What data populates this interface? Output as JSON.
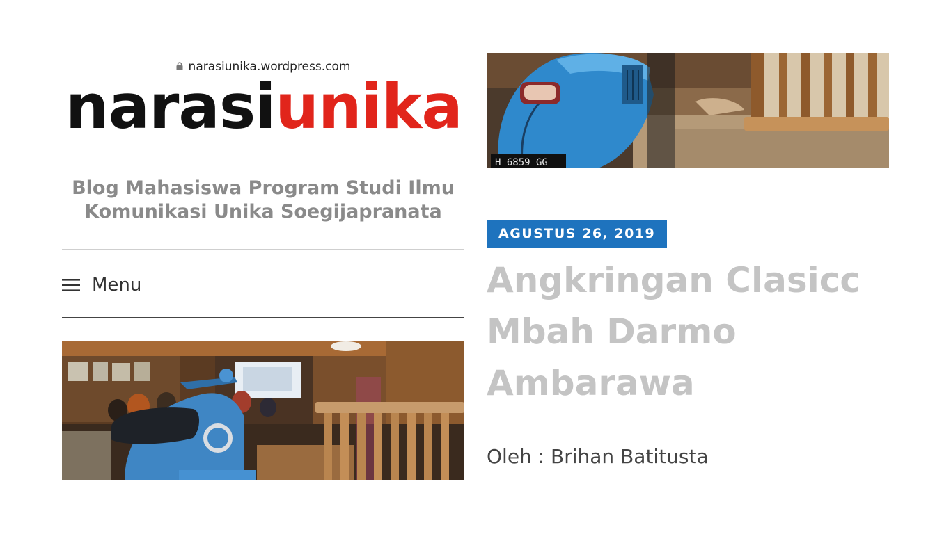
{
  "browser": {
    "url": "narasiunika.wordpress.com"
  },
  "site": {
    "logo_part1": "narasi",
    "logo_part2": "unika",
    "tagline": "Blog Mahasiswa Program Studi Ilmu Komunikasi Unika Soegijapranata",
    "menu_label": "Menu"
  },
  "post": {
    "date": "AGUSTUS 26, 2019",
    "title": "Angkringan Clasicc Mbah Darmo Ambarawa",
    "byline": "Oleh : Brihan Batitusta"
  },
  "images": {
    "left_photo": "cafe-interior-with-blue-scooter",
    "right_photo": "blue-scooter-rear-closeup",
    "plate_text": "H 6859 GG"
  },
  "colors": {
    "logo_dark": "#111111",
    "logo_red": "#e1251b",
    "date_badge": "#1e73be",
    "title_gray": "#c4c4c4",
    "tagline_gray": "#8a8a8a"
  },
  "icons": [
    "lock-icon",
    "hamburger-menu-icon"
  ]
}
